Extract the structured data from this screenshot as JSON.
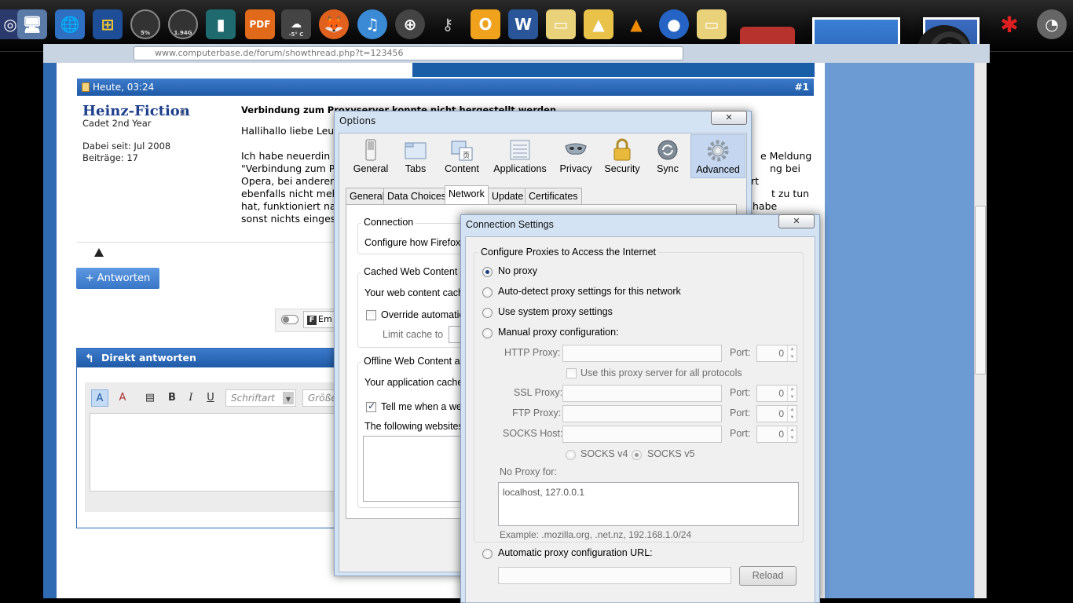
{
  "dock": {
    "weather_temp": "-5° C",
    "pdf_label": "PDF",
    "gauge1_label": "5%",
    "gauge2_label": "1.94G"
  },
  "browser": {
    "url": "www.computerbase.de/forum/showthread.php?t=123456"
  },
  "forum": {
    "post_date": "Heute, 03:24",
    "post_number": "#1",
    "username": "Heinz-Fiction",
    "user_rank": "Cadet 2nd Year",
    "member_since": "Dabei seit: Jul 2008",
    "posts_count": "Beiträge: 17",
    "post_title": "Verbindung zum Proxyserver konnte nicht hergestellt werden",
    "post_lines": [
      "Hallihallo liebe Leu",
      "",
      "Ich habe neuerdin",
      "\"Verbindung zum P",
      "Opera, bei anderer",
      "ebenfalls nicht meh",
      "hat, funktioniert na",
      "sonst nichts einges"
    ],
    "post_lines_right": [
      "e Meldung",
      "ng bei",
      "rt",
      "t zu tun",
      "habe"
    ],
    "reply_button": "+ Antworten",
    "share_label": "Em",
    "direct_reply_title": "Direkt antworten",
    "font_select": "Schriftart",
    "size_select": "Größe"
  },
  "options": {
    "title": "Options",
    "categories": [
      "General",
      "Tabs",
      "Content",
      "Applications",
      "Privacy",
      "Security",
      "Sync",
      "Advanced"
    ],
    "tabs": [
      "General",
      "Data Choices",
      "Network",
      "Update",
      "Certificates"
    ],
    "connection_group": "Connection",
    "connection_text": "Configure how Firefox",
    "cache_group": "Cached Web Content",
    "cache_text": "Your web content cach",
    "override_label": "Override automatic",
    "limit_label": "Limit cache to",
    "offline_group": "Offline Web Content an",
    "offline_text": "Your application cache",
    "tell_me_label": "Tell me when a wel",
    "following_text": "The following websites"
  },
  "connection_settings": {
    "title": "Connection Settings",
    "group_title": "Configure Proxies to Access the Internet",
    "radio_no_proxy": "No proxy",
    "radio_auto_detect": "Auto-detect proxy settings for this network",
    "radio_system": "Use system proxy settings",
    "radio_manual": "Manual proxy configuration:",
    "http_label": "HTTP Proxy:",
    "ssl_label": "SSL Proxy:",
    "ftp_label": "FTP Proxy:",
    "socks_label": "SOCKS Host:",
    "port_label": "Port:",
    "http_port": "0",
    "ssl_port": "0",
    "ftp_port": "0",
    "socks_port": "0",
    "use_for_all": "Use this proxy server for all protocols",
    "socks_v4": "SOCKS v4",
    "socks_v5": "SOCKS v5",
    "no_proxy_for": "No Proxy for:",
    "no_proxy_value": "localhost, 127.0.0.1",
    "example": "Example: .mozilla.org, .net.nz, 192.168.1.0/24",
    "auto_config_url": "Automatic proxy configuration URL:",
    "reload": "Reload"
  }
}
